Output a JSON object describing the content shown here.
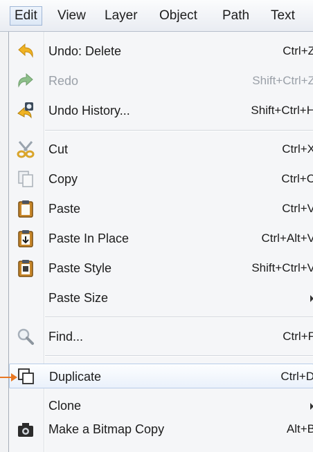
{
  "menubar": {
    "items": [
      {
        "label": "Edit",
        "active": true
      },
      {
        "label": "View"
      },
      {
        "label": "Layer"
      },
      {
        "label": "Object"
      },
      {
        "label": "Path"
      },
      {
        "label": "Text"
      }
    ]
  },
  "menu": {
    "undo": {
      "label": "Undo: Delete",
      "shortcut": "Ctrl+Z",
      "icon": "undo-arrow-icon"
    },
    "redo": {
      "label": "Redo",
      "shortcut": "Shift+Ctrl+Z",
      "icon": "redo-arrow-icon",
      "disabled": true
    },
    "undo_history": {
      "label": "Undo History...",
      "shortcut": "Shift+Ctrl+H",
      "icon": "undo-history-icon"
    },
    "cut": {
      "label": "Cut",
      "shortcut": "Ctrl+X",
      "icon": "scissors-icon",
      "disabled_icon": true
    },
    "copy": {
      "label": "Copy",
      "shortcut": "Ctrl+C",
      "icon": "copy-icon",
      "disabled_icon": true
    },
    "paste": {
      "label": "Paste",
      "shortcut": "Ctrl+V",
      "icon": "clipboard-icon"
    },
    "paste_in_place": {
      "label": "Paste In Place",
      "shortcut": "Ctrl+Alt+V",
      "icon": "paste-in-place-icon"
    },
    "paste_style": {
      "label": "Paste Style",
      "shortcut": "Shift+Ctrl+V",
      "icon": "paste-style-icon"
    },
    "paste_size": {
      "label": "Paste Size",
      "has_submenu": true
    },
    "find": {
      "label": "Find...",
      "shortcut": "Ctrl+F",
      "icon": "magnifier-icon",
      "disabled_icon": true
    },
    "duplicate": {
      "label": "Duplicate",
      "shortcut": "Ctrl+D",
      "icon": "duplicate-icon",
      "highlighted": true
    },
    "clone": {
      "label": "Clone",
      "has_submenu": true
    },
    "bitmap_copy": {
      "label": "Make a Bitmap Copy",
      "shortcut": "Alt+B",
      "icon": "camera-icon"
    }
  },
  "colors": {
    "pointer_arrow": "#e87722",
    "highlight_border": "#b8cde8",
    "disabled_text": "#9aa0a8"
  }
}
